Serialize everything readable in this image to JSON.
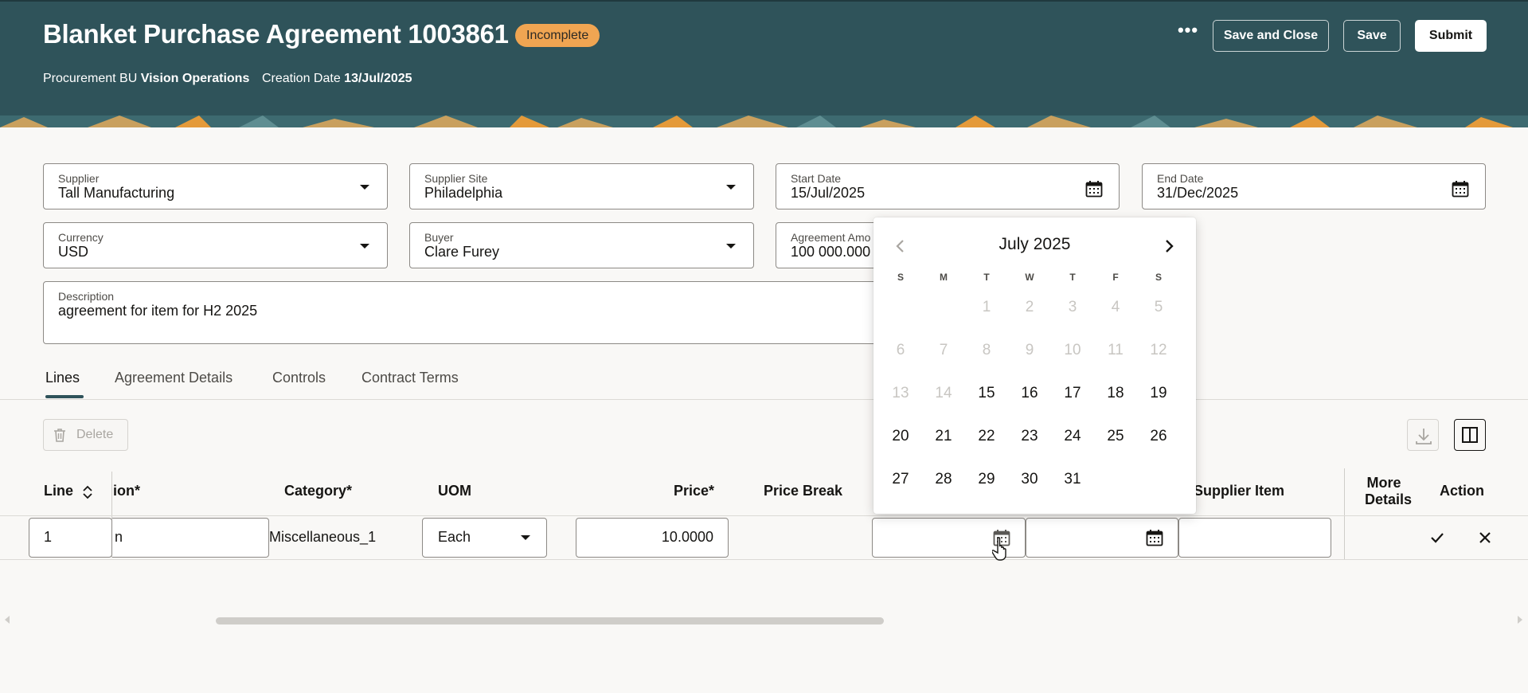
{
  "header": {
    "title": "Blanket Purchase Agreement 1003861",
    "status_badge": "Incomplete",
    "procurement_bu_label": "Procurement BU",
    "procurement_bu_value": "Vision Operations",
    "creation_date_label": "Creation Date",
    "creation_date_value": "13/Jul/2025",
    "more_actions": "•••",
    "save_and_close_label": "Save and Close",
    "save_label": "Save",
    "submit_label": "Submit"
  },
  "form": {
    "supplier": {
      "label": "Supplier",
      "value": "Tall Manufacturing"
    },
    "supplier_site": {
      "label": "Supplier Site",
      "value": "Philadelphia"
    },
    "start_date": {
      "label": "Start Date",
      "value": "15/Jul/2025"
    },
    "end_date": {
      "label": "End Date",
      "value": "31/Dec/2025"
    },
    "currency": {
      "label": "Currency",
      "value": "USD"
    },
    "buyer": {
      "label": "Buyer",
      "value": "Clare Furey"
    },
    "agreement_amount": {
      "label": "Agreement Amo",
      "value": "100 000.000"
    },
    "description": {
      "label": "Description",
      "value": "agreement for item for H2 2025"
    }
  },
  "tabs": [
    {
      "label": "Lines",
      "active": true
    },
    {
      "label": "Agreement Details",
      "active": false
    },
    {
      "label": "Controls",
      "active": false
    },
    {
      "label": "Contract Terms",
      "active": false
    }
  ],
  "toolbar": {
    "delete_label": "Delete"
  },
  "table": {
    "headers": {
      "line": "Line",
      "description": "ion*",
      "category": "Category*",
      "uom": "UOM",
      "price": "Price*",
      "price_break": "Price Break",
      "supplier_item": "Supplier Item",
      "more_details_1": "More",
      "more_details_2": "Details",
      "action": "Action"
    },
    "row": {
      "line": "1",
      "description": "n",
      "category": "Miscellaneous_1",
      "uom": "Each",
      "price": "10.0000",
      "start_date": "",
      "end_date": "",
      "supplier_item": ""
    }
  },
  "datepicker": {
    "month_label": "July 2025",
    "weekdays": [
      "S",
      "M",
      "T",
      "W",
      "T",
      "F",
      "S"
    ],
    "weeks": [
      [
        "",
        "",
        "1",
        "2",
        "3",
        "4",
        "5"
      ],
      [
        "6",
        "7",
        "8",
        "9",
        "10",
        "11",
        "12"
      ],
      [
        "13",
        "14",
        "15",
        "16",
        "17",
        "18",
        "19"
      ],
      [
        "20",
        "21",
        "22",
        "23",
        "24",
        "25",
        "26"
      ],
      [
        "27",
        "28",
        "29",
        "30",
        "31",
        "",
        ""
      ]
    ],
    "first_enabled_day": 15
  },
  "colors": {
    "header_bg": "#2f535a",
    "badge_bg": "#f0a552",
    "page_bg": "#f9f8f6"
  }
}
